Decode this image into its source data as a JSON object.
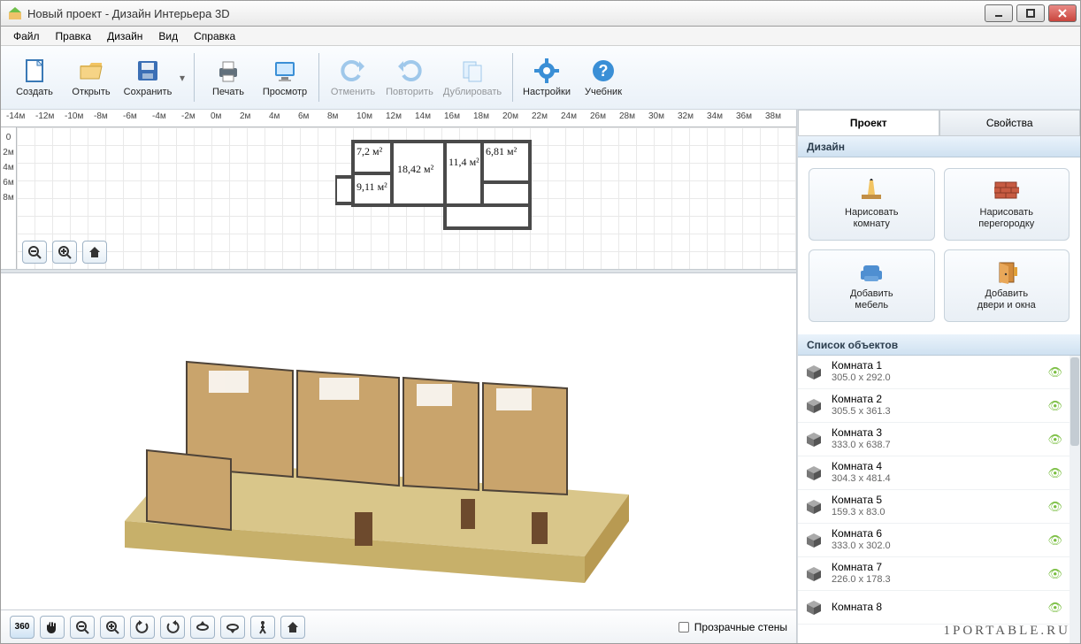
{
  "window": {
    "title": "Новый проект - Дизайн Интерьера 3D"
  },
  "menu": {
    "items": [
      "Файл",
      "Правка",
      "Дизайн",
      "Вид",
      "Справка"
    ]
  },
  "toolbar": {
    "create": "Создать",
    "open": "Открыть",
    "save": "Сохранить",
    "print": "Печать",
    "preview": "Просмотр",
    "undo": "Отменить",
    "redo": "Повторить",
    "duplicate": "Дублировать",
    "settings": "Настройки",
    "tutorial": "Учебник"
  },
  "ruler": {
    "hticks": [
      "-14м",
      "-12м",
      "-10м",
      "-8м",
      "-6м",
      "-4м",
      "-2м",
      "0м",
      "2м",
      "4м",
      "6м",
      "8м",
      "10м",
      "12м",
      "14м",
      "16м",
      "18м",
      "20м",
      "22м",
      "24м",
      "26м",
      "28м",
      "30м",
      "32м",
      "34м",
      "36м",
      "38м"
    ],
    "vticks": [
      "0",
      "2м",
      "4м",
      "6м",
      "8м"
    ]
  },
  "floorplan": {
    "rooms": [
      {
        "area": "7,2",
        "unit": "м²"
      },
      {
        "area": "18,42",
        "unit": "м²"
      },
      {
        "area": "11,4",
        "unit": "м²"
      },
      {
        "area": "6,81",
        "unit": "м²"
      },
      {
        "area": "9,11",
        "unit": "м²"
      }
    ]
  },
  "right": {
    "tabs": {
      "project": "Проект",
      "properties": "Свойства"
    },
    "design_header": "Дизайн",
    "design_btns": {
      "draw_room": "Нарисовать\nкомнату",
      "draw_wall": "Нарисовать\nперегородку",
      "add_furniture": "Добавить\nмебель",
      "add_doors": "Добавить\nдвери и окна"
    },
    "objects_header": "Список объектов",
    "objects": [
      {
        "name": "Комната 1",
        "dim": "305.0 x 292.0"
      },
      {
        "name": "Комната 2",
        "dim": "305.5 x 361.3"
      },
      {
        "name": "Комната 3",
        "dim": "333.0 x 638.7"
      },
      {
        "name": "Комната 4",
        "dim": "304.3 x 481.4"
      },
      {
        "name": "Комната 5",
        "dim": "159.3 x 83.0"
      },
      {
        "name": "Комната 6",
        "dim": "333.0 x 302.0"
      },
      {
        "name": "Комната 7",
        "dim": "226.0 x 178.3"
      },
      {
        "name": "Комната 8",
        "dim": ""
      }
    ]
  },
  "bottom": {
    "transparent_walls": "Прозрачные стены"
  },
  "watermark": "1PORTABLE.RU"
}
